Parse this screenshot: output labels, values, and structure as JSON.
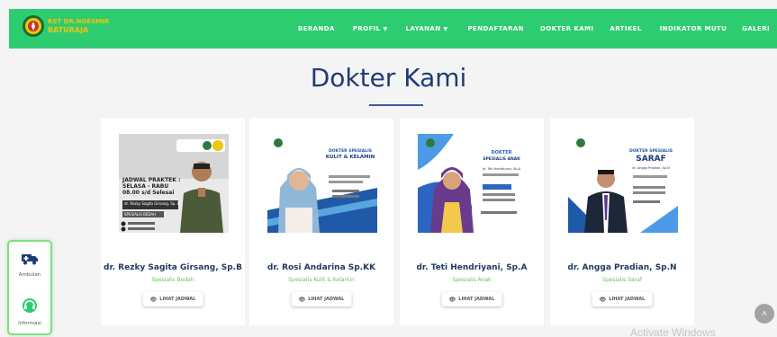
{
  "brand": {
    "line1": "RST DR.NOESMIR",
    "line2": "BATURAJA"
  },
  "nav": {
    "items": [
      {
        "label": "BERANDA",
        "dropdown": false
      },
      {
        "label": "PROFIL",
        "dropdown": true
      },
      {
        "label": "LAYANAN",
        "dropdown": true
      },
      {
        "label": "PENDAFTARAN",
        "dropdown": false
      },
      {
        "label": "DOKTER KAMI",
        "dropdown": false
      },
      {
        "label": "ARTIKEL",
        "dropdown": false
      },
      {
        "label": "INDIKATOR MUTU",
        "dropdown": false
      },
      {
        "label": "GALERI",
        "dropdown": false
      }
    ]
  },
  "page": {
    "title": "Dokter Kami"
  },
  "doctors": [
    {
      "name": "dr. Rezky Sagita Girsang, Sp.B",
      "specialty": "Spesialis Bedah",
      "button": "LIHAT JADWAL"
    },
    {
      "name": "dr. Rosi Andarina Sp.KK",
      "specialty": "Spesialis Kulit & Kelamin",
      "button": "LIHAT JADWAL"
    },
    {
      "name": "dr. Teti Hendriyani, Sp.A",
      "specialty": "Spesialis Anak",
      "button": "LIHAT JADWAL"
    },
    {
      "name": "dr. Angga Pradian, Sp.N",
      "specialty": "Spesialis Saraf",
      "button": "LIHAT JADWAL"
    }
  ],
  "posters": {
    "p1": {
      "heading": "JADWAL PRAKTEK :",
      "days": "SELASA - RABU",
      "hours": "08.00 s/d Selesai",
      "name_strip": "dr. Rezky Sagita Girsang, Sp. B",
      "spec_strip": "SPESIALIS BEDAH"
    },
    "p2": {
      "heading_top": "DOKTER SPESIALIS",
      "heading_main": "KULIT & KELAMIN"
    },
    "p3": {
      "heading_top": "DOKTER",
      "heading_main": "SPESIALIS ANAK",
      "doctor": "dr. Teti Hendriyani, Sp.A"
    },
    "p4": {
      "heading_top": "DOKTER SPESIALIS",
      "heading_main": "SARAF",
      "doctor": "dr. Angga Pradian, Sp.N"
    }
  },
  "widget": {
    "items": [
      {
        "label": "Ambulan",
        "icon": "ambulance-icon"
      },
      {
        "label": "Informasi",
        "icon": "headset-icon"
      }
    ]
  },
  "overlay": {
    "watermark": "Activate Windows",
    "scroll_top_icon": "chevron-up-icon"
  },
  "colors": {
    "nav_bg": "#2ecc71",
    "title": "#1e3b78",
    "doctor_name": "#1f3a60",
    "specialty": "#6bbf5b",
    "brand_yellow": "#f1c40f"
  }
}
